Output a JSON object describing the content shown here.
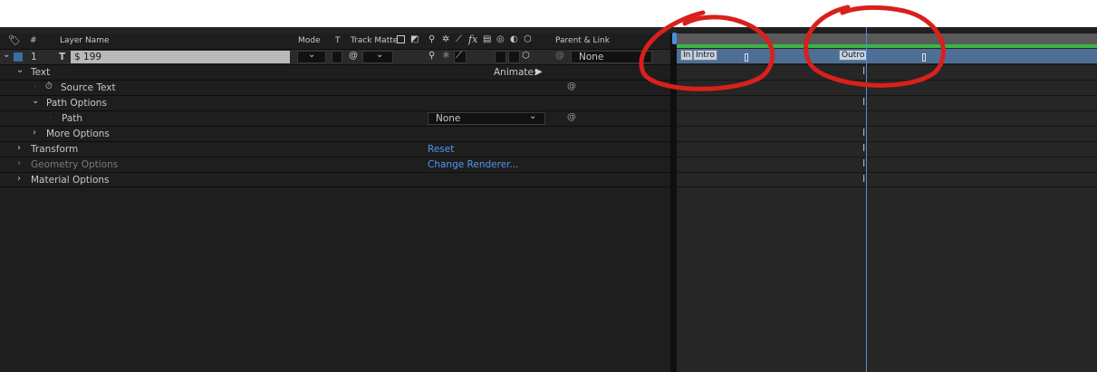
{
  "header": {
    "layer_name": "Layer Name",
    "number": "#",
    "mode": "Mode",
    "t": "T",
    "track_matte": "Track Matte",
    "parent_link": "Parent & Link"
  },
  "layer": {
    "number": "1",
    "type_glyph": "T",
    "name": "$ 199",
    "parent_value": "None",
    "color": "#3b6ea5"
  },
  "properties": {
    "text": "Text",
    "animate": "Animate:",
    "source_text": "Source Text",
    "path_options": "Path Options",
    "path": "Path",
    "path_value": "None",
    "more_options": "More Options",
    "transform": "Transform",
    "reset": "Reset",
    "geometry_options": "Geometry Options",
    "change_renderer": "Change Renderer...",
    "material_options": "Material Options"
  },
  "timeline": {
    "marker_in_partial": "In",
    "marker_intro": "Intro",
    "marker_outro": "Outro",
    "accent": "#4a8fe0",
    "annotation": "#d8201c"
  }
}
